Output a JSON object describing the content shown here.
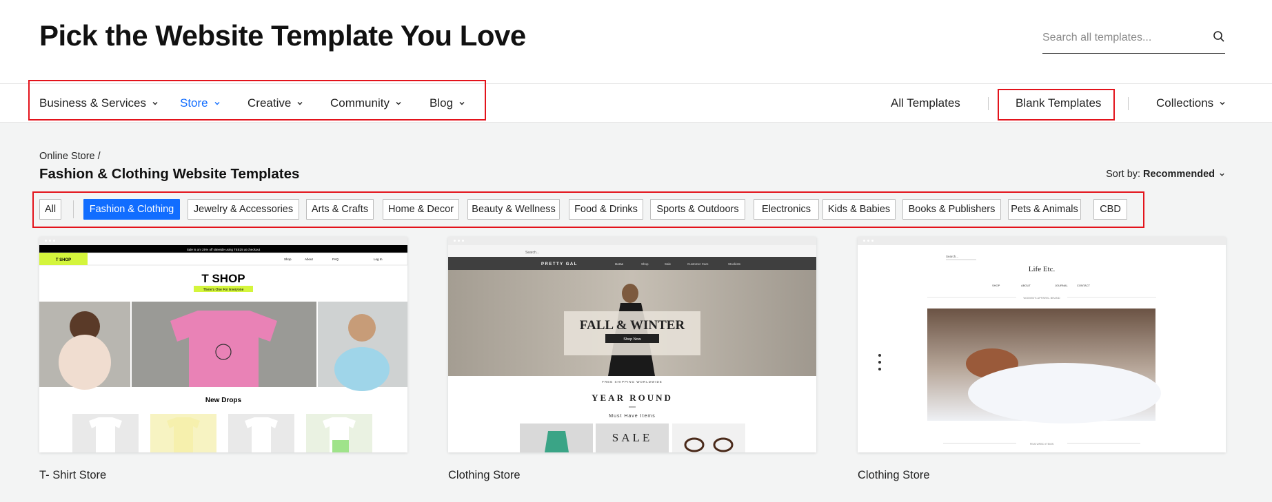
{
  "header": {
    "title": "Pick the Website Template You Love",
    "search_placeholder": "Search all templates..."
  },
  "nav": {
    "left": [
      {
        "label": "Business & Services",
        "active": false
      },
      {
        "label": "Store",
        "active": true
      },
      {
        "label": "Creative",
        "active": false
      },
      {
        "label": "Community",
        "active": false
      },
      {
        "label": "Blog",
        "active": false
      }
    ],
    "right": {
      "all_templates": "All Templates",
      "blank_templates": "Blank Templates",
      "collections": "Collections"
    }
  },
  "page": {
    "breadcrumb": "Online Store /",
    "title": "Fashion & Clothing Website Templates",
    "sort_label": "Sort by:",
    "sort_value": "Recommended"
  },
  "filters": [
    {
      "label": "All",
      "active": false
    },
    {
      "label": "Fashion & Clothing",
      "active": true
    },
    {
      "label": "Jewelry & Accessories",
      "active": false
    },
    {
      "label": "Arts & Crafts",
      "active": false
    },
    {
      "label": "Home & Decor",
      "active": false
    },
    {
      "label": "Beauty & Wellness",
      "active": false
    },
    {
      "label": "Food & Drinks",
      "active": false
    },
    {
      "label": "Sports & Outdoors",
      "active": false
    },
    {
      "label": "Electronics",
      "active": false
    },
    {
      "label": "Kids & Babies",
      "active": false
    },
    {
      "label": "Books & Publishers",
      "active": false
    },
    {
      "label": "Pets & Animals",
      "active": false
    },
    {
      "label": "CBD",
      "active": false
    }
  ],
  "templates": [
    {
      "name": "T- Shirt Store",
      "preview": {
        "promo": "Sale is on! 25% off sitewide using TEE25 at checkout",
        "logo": "T SHOP",
        "menu": [
          "Shop",
          "About",
          "FAQ",
          "Log In"
        ],
        "hero_title": "T SHOP",
        "hero_sub": "There's One For Everyone",
        "section": "New Drops"
      }
    },
    {
      "name": "Clothing Store",
      "preview": {
        "search": "Search...",
        "brand": "PRETTY GAL",
        "menu": [
          "Home",
          "Shop",
          "Sale",
          "Customer Care",
          "Stockists"
        ],
        "hero_title": "FALL & WINTER",
        "hero_button": "Shop Now",
        "shipping": "FREE SHIPPING WORLDWIDE",
        "section": "YEAR ROUND",
        "section_sub": "Must Have Items",
        "sale": "SALE"
      }
    },
    {
      "name": "Clothing Store",
      "preview": {
        "search": "Search...",
        "brand": "Life Etc.",
        "menu": [
          "SHOP",
          "ABOUT",
          "JOURNAL",
          "CONTACT"
        ],
        "tagline": "WOMEN'S APPAREL BRAND",
        "featured": "FEATURED ITEMS"
      }
    }
  ],
  "colors": {
    "accent": "#116dff",
    "highlight_box": "#e3131b",
    "tshop_lime": "#d4f53c",
    "page_bg": "#f3f4f4"
  }
}
